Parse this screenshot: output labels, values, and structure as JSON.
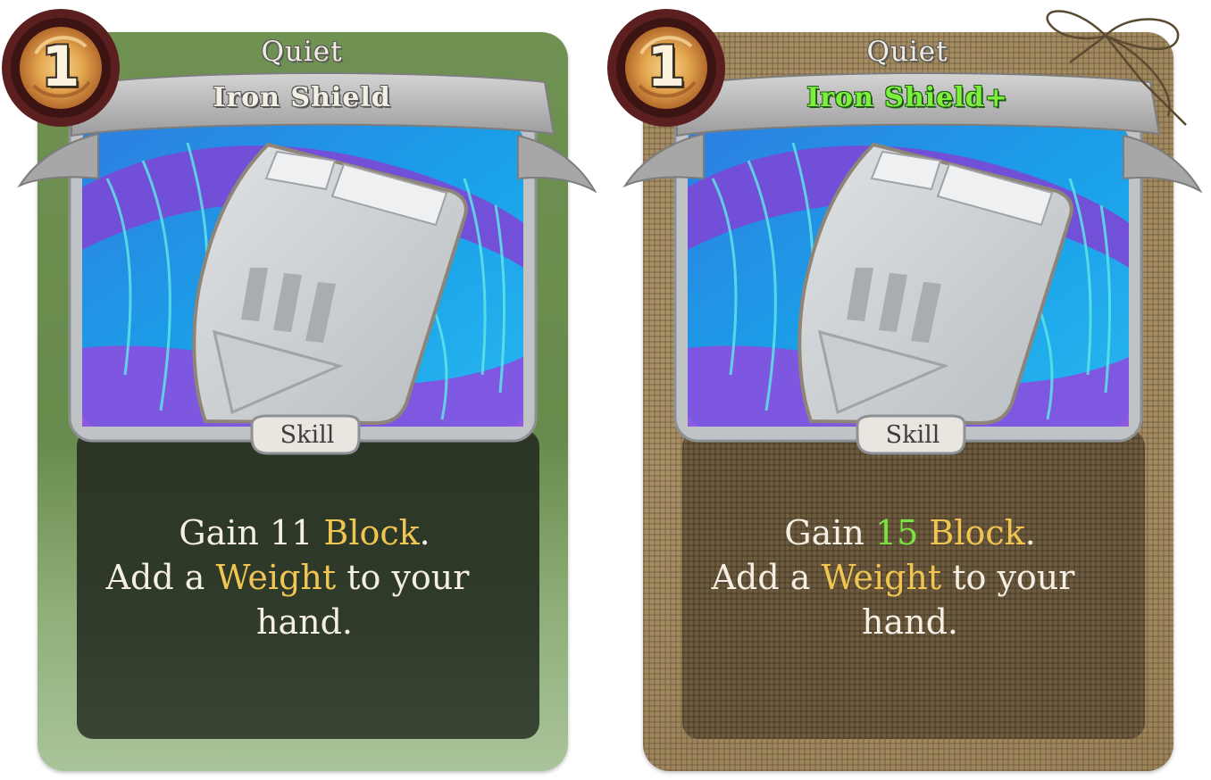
{
  "cards": [
    {
      "id": "base",
      "cost": "1",
      "owner": "Quiet",
      "name": "Iron Shield",
      "upgraded": false,
      "type": "Skill",
      "description": {
        "line1_prefix": "Gain ",
        "block_amount": "11",
        "line1_keyword": " Block",
        "line1_suffix": ".",
        "line2_prefix": "Add a ",
        "line2_keyword": "Weight",
        "line2_suffix": " to your",
        "line3": "hand."
      },
      "colors": {
        "frame": "#678b4c",
        "desc_panel": "#2f3a2a",
        "keyword": "#f1c552"
      }
    },
    {
      "id": "upgraded",
      "cost": "1",
      "owner": "Quiet",
      "name": "Iron Shield+",
      "upgraded": true,
      "type": "Skill",
      "description": {
        "line1_prefix": "Gain ",
        "block_amount": "15",
        "line1_keyword": " Block",
        "line1_suffix": ".",
        "line2_prefix": "Add a ",
        "line2_keyword": "Weight",
        "line2_suffix": " to your",
        "line3": "hand."
      },
      "colors": {
        "frame": "#a58e66",
        "desc_panel": "#6c5b3f",
        "keyword": "#f1c552",
        "upgrade": "#7cf03c"
      }
    }
  ],
  "icons": {
    "cost_orb": "cost-orb-icon",
    "art": "iron-shield-art-icon",
    "twine": "twine-bow-icon"
  }
}
